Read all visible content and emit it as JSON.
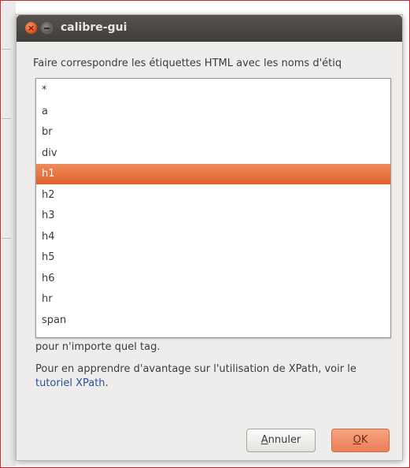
{
  "window": {
    "title": "calibre-gui"
  },
  "dialog": {
    "heading": "Faire correspondre les étiquettes HTML avec les noms d'étiq",
    "tags": [
      "*",
      "a",
      "br",
      "div",
      "h1",
      "h2",
      "h3",
      "h4",
      "h5",
      "h6",
      "hr",
      "span"
    ],
    "selected_tag": "h1",
    "help_line1": "pour n'importe quel tag.",
    "help_line2_prefix": "Pour en apprendre d'avantage sur l'utilisation de XPath, voir le ",
    "help_link": "tutoriel XPath",
    "help_line2_suffix": ".",
    "cancel_label": "Annuler",
    "ok_label": "OK"
  },
  "colors": {
    "selection": "#e8733f",
    "titlebar": "#3f3d39",
    "link": "#2a4f9e",
    "accent_button": "#ec7e56"
  }
}
